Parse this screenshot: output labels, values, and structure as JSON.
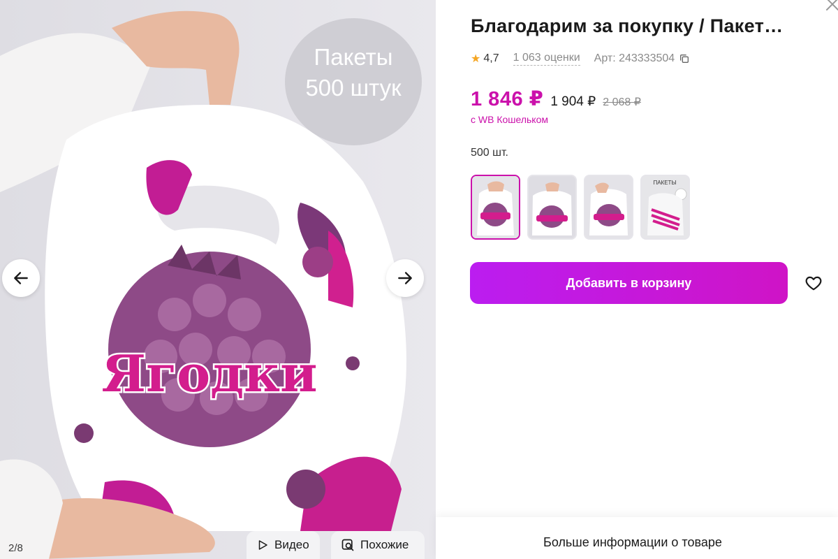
{
  "gallery": {
    "promo_text": "Пакеты\n500 штук",
    "bag_brand_text": "Ягодки",
    "counter": "2/8",
    "video_label": "Видео",
    "similar_label": "Похожие"
  },
  "product": {
    "title": "Благодарим за покупку / Пакет…",
    "rating": "4,7",
    "reviews": "1 063 оценки",
    "article": "Арт: 243333504",
    "price_main": "1 846 ₽",
    "price_old": "1 904 ₽",
    "price_strike": "2 068 ₽",
    "wallet_note": "с WB Кошельком",
    "quantity_label": "500 шт.",
    "thumbnails": [
      {
        "alt": "Ягодки",
        "active": true
      },
      {
        "alt": "Ягодки",
        "active": false
      },
      {
        "alt": "Ягодки",
        "active": false
      },
      {
        "alt": "ПАКЕТЫ",
        "active": false
      }
    ],
    "add_to_cart": "Добавить в корзину",
    "more_info": "Больше информации о товаре"
  },
  "colors": {
    "accent": "#cb11ab",
    "button_gradient_start": "#bb1df0",
    "button_gradient_end": "#cf14c6",
    "star": "#f5a623"
  },
  "icons": {
    "prev": "arrow-left-icon",
    "next": "arrow-right-icon",
    "video": "play-icon",
    "similar": "image-search-icon",
    "copy": "copy-icon",
    "close": "close-icon",
    "favorite": "heart-icon",
    "rating": "star-icon"
  }
}
